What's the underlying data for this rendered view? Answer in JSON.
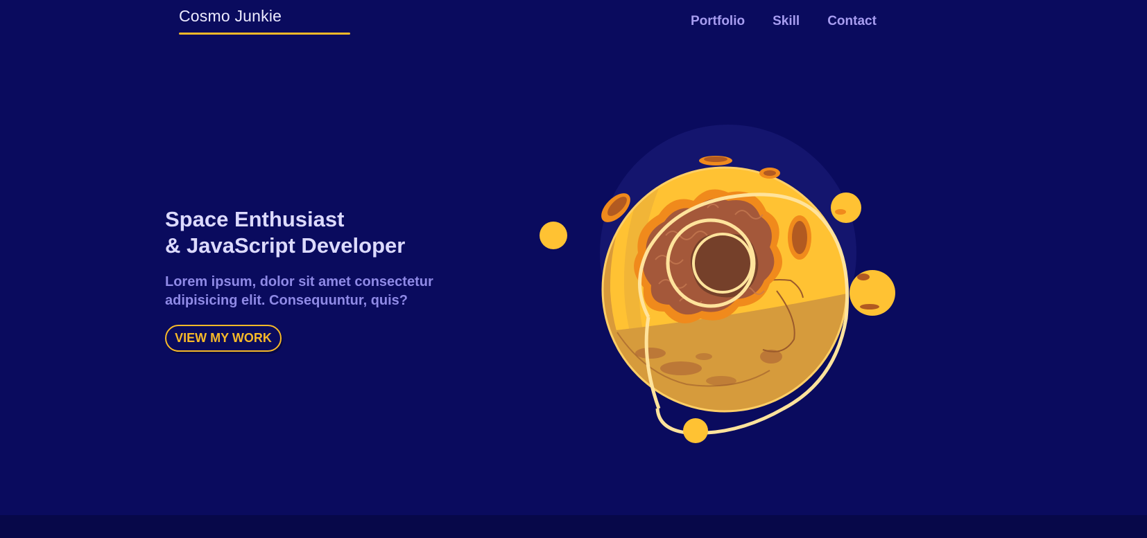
{
  "header": {
    "logo": "Cosmo Junkie",
    "nav": [
      "Portfolio",
      "Skill",
      "Contact"
    ]
  },
  "hero": {
    "title_line1": "Space Enthusiast",
    "title_line2": "& JavaScript Developer",
    "desc_line1": "Lorem ipsum, dolor sit amet consectetur",
    "desc_line2": "adipisicing elit. Consequuntur, quis?",
    "cta": "VIEW MY WORK"
  },
  "colors": {
    "background": "#0a0b5e",
    "accent": "#f7b928",
    "title": "#dcdafe",
    "muted": "#8f8ae6"
  },
  "illustration": {
    "name": "planet-illustration"
  }
}
